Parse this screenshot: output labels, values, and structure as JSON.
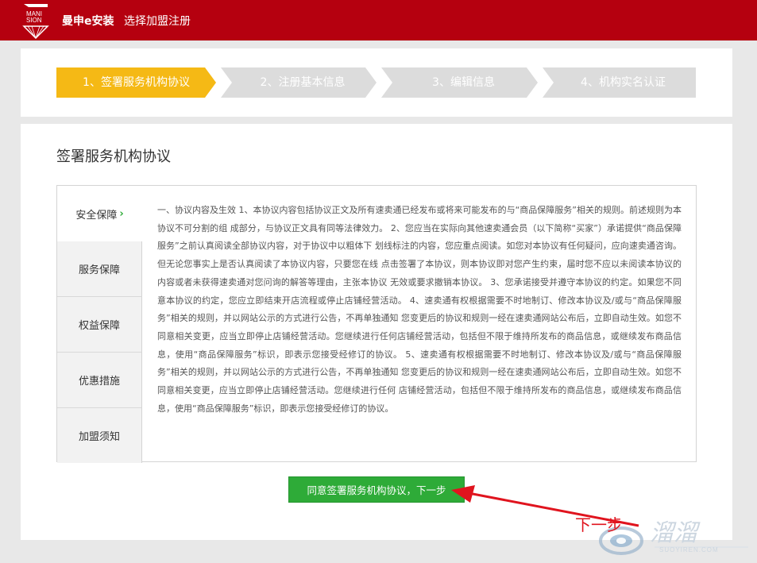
{
  "header": {
    "logo_text_lines": [
      "MANI",
      "SION"
    ],
    "brand": "曼申e安装",
    "subtitle": "选择加盟注册"
  },
  "steps": [
    {
      "label": "1、签署服务机构协议",
      "state": "active"
    },
    {
      "label": "2、注册基本信息",
      "state": "inactive"
    },
    {
      "label": "3、编辑信息",
      "state": "inactive"
    },
    {
      "label": "4、机构实名认证",
      "state": "inactive"
    }
  ],
  "main": {
    "title": "签署服务机构协议",
    "tabs": [
      {
        "label": "安全保障",
        "active": true
      },
      {
        "label": "服务保障",
        "active": false
      },
      {
        "label": "权益保障",
        "active": false
      },
      {
        "label": "优惠措施",
        "active": false
      },
      {
        "label": "加盟须知",
        "active": false
      }
    ],
    "agreement_text": "一、协议内容及生效 1、本协议内容包括协议正文及所有速卖通已经发布或将来可能发布的与“商品保障服务”相关的规则。前述规则为本协议不可分割的组 成部分，与协议正文具有同等法律效力。 2、您应当在实际向其他速卖通会员（以下简称“买家”）承诺提供“商品保障服务”之前认真阅读全部协议内容，对于协议中以粗体下 划线标注的内容，您应重点阅读。如您对本协议有任何疑问，应向速卖通咨询。但无论您事实上是否认真阅读了本协议内容，只要您在线 点击签署了本协议，则本协议即对您产生约束，届时您不应以未阅读本协议的内容或者未获得速卖通对您问询的解答等理由，主张本协议 无效或要求撤销本协议。 3、您承诺接受并遵守本协议的约定。如果您不同意本协议的约定，您应立即结束开店流程或停止店铺经营活动。 4、速卖通有权根据需要不时地制订、修改本协议及/或与“商品保障服务”相关的规则，并以网站公示的方式进行公告，不再单独通知 您变更后的协议和规则一经在速卖通网站公布后，立即自动生效。如您不同意相关变更，应当立即停止店铺经营活动。您继续进行任何店铺经营活动，包括但不限于维持所发布的商品信息，或继续发布商品信息，使用“商品保障服务”标识，即表示您接受经修订的协议。 5、速卖通有权根据需要不时地制订、修改本协议及/或与“商品保障服务”相关的规则，并以网站公示的方式进行公告，不再单独通知 您变更后的协议和规则一经在速卖通网站公布后，立即自动生效。如您不同意相关变更，应当立即停止店铺经营活动。您继续进行任何 店铺经营活动，包括但不限于维持所发布的商品信息，或继续发布商品信息，使用“商品保障服务”标识，即表示您接受经修订的协议。",
    "agree_button": "同意签署服务机构协议，下一步"
  },
  "annotation": {
    "text": "下一步",
    "color": "#e0141e"
  },
  "watermark": {
    "text": "溜溜",
    "url": "SUOYIREN.COM"
  },
  "colors": {
    "topbar": "#b5000f",
    "active_step": "#f5b915",
    "inactive_step": "#dcdcdc",
    "button": "#2eab38"
  }
}
